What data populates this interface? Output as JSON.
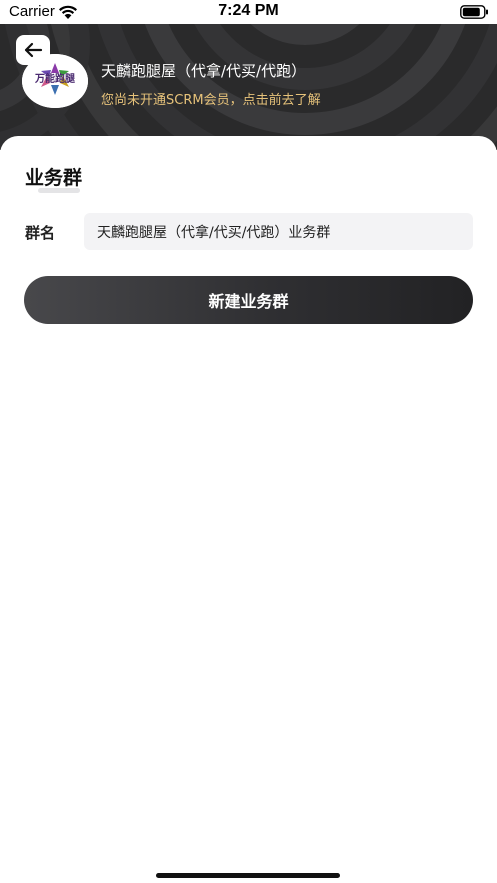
{
  "status_bar": {
    "carrier": "Carrier",
    "time": "7:24 PM",
    "icons": [
      "wifi-icon",
      "battery-icon"
    ]
  },
  "header": {
    "back_icon": "arrow-left-icon",
    "shop_name": "天麟跑腿屋（代拿/代买/代跑）",
    "member_tip": "您尚未开通SCRM会员，点击前去了解",
    "logo_text": "万能跑腿",
    "colors": {
      "background": "#2b2b2c",
      "tip": "#e6c27a"
    }
  },
  "section": {
    "title": "业务群"
  },
  "form": {
    "group_name_label": "群名",
    "group_name_value": "天麟跑腿屋（代拿/代买/代跑）业务群"
  },
  "actions": {
    "create_label": "新建业务群"
  }
}
